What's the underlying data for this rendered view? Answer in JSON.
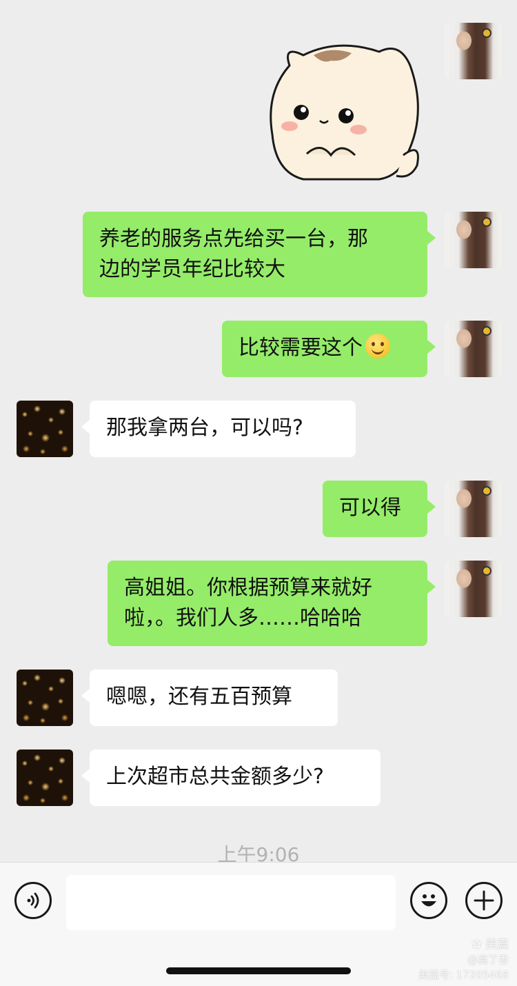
{
  "messages": [
    {
      "side": "me",
      "text": "养老的服务点先给买一台，那\n边的学员年纪比较大"
    },
    {
      "side": "me",
      "text": "比较需要这个",
      "emoji": "smiling-face-emoji"
    },
    {
      "side": "other",
      "text": "那我拿两台，可以吗?"
    },
    {
      "side": "me",
      "text": "可以得"
    },
    {
      "side": "me",
      "text": "高姐姐。你根据预算来就好\n啦，。我们人多……哈哈哈"
    },
    {
      "side": "other",
      "text": "嗯嗯，还有五百预算"
    },
    {
      "side": "other",
      "text": "上次超市总共金额多少?"
    }
  ],
  "timestamp": "上午9:06",
  "input": {
    "value": "",
    "placeholder": ""
  },
  "icons": {
    "voice": "voice-input-icon",
    "emoji": "emoji-picker-icon",
    "more": "more-plus-icon"
  },
  "watermark": {
    "brand": "美篇",
    "line2": "@高丁香",
    "line3": "美篇号: 17205468"
  },
  "colors": {
    "background": "#ededed",
    "my_bubble": "#95ec69",
    "their_bubble": "#ffffff",
    "timestamp": "#b2b2b2"
  }
}
